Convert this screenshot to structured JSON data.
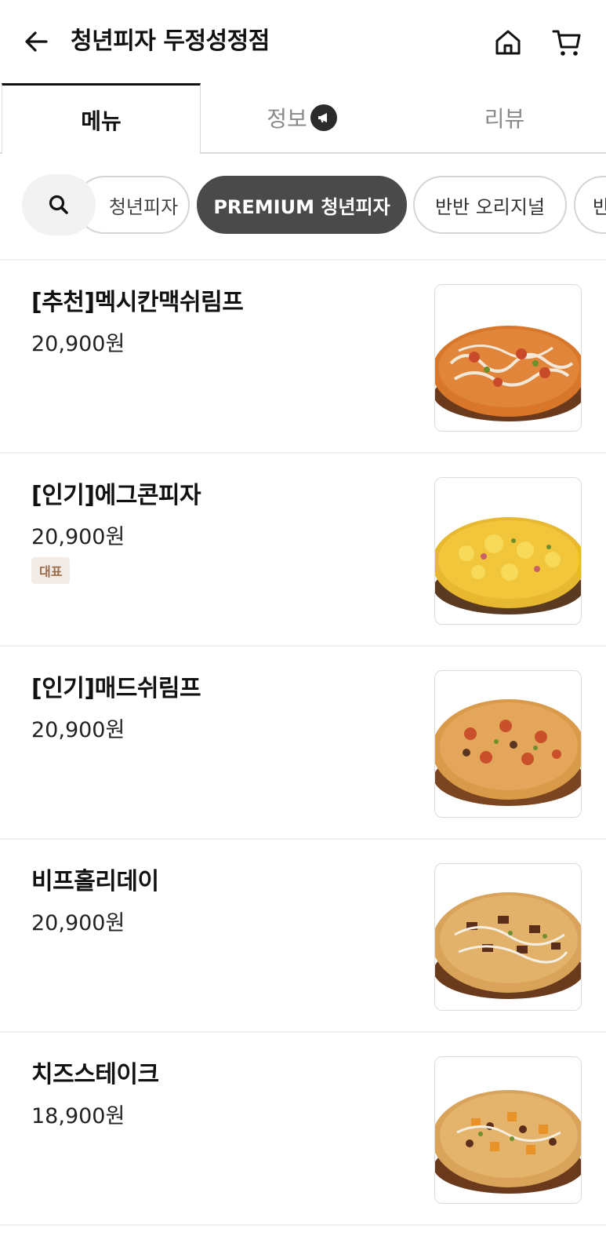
{
  "header": {
    "title": "청년피자 두정성정점",
    "back_icon": "arrow-left-icon",
    "home_icon": "home-icon",
    "cart_icon": "cart-icon"
  },
  "tabs": [
    {
      "label": "메뉴",
      "active": true
    },
    {
      "label": "정보",
      "active": false,
      "badge_icon": "megaphone-icon"
    },
    {
      "label": "리뷰",
      "active": false
    }
  ],
  "categories": {
    "search_icon": "search-icon",
    "chips": [
      {
        "label": "청년피자",
        "selected": false
      },
      {
        "label": "PREMIUM 청년피자",
        "selected": true
      },
      {
        "label": "반반 오리지널",
        "selected": false
      },
      {
        "label": "반",
        "selected": false
      }
    ]
  },
  "menu": [
    {
      "name": "[추천]멕시칸맥쉬림프",
      "price": "20,900원",
      "badge": ""
    },
    {
      "name": "[인기]에그콘피자",
      "price": "20,900원",
      "badge": "대표"
    },
    {
      "name": "[인기]매드쉬림프",
      "price": "20,900원",
      "badge": ""
    },
    {
      "name": "비프홀리데이",
      "price": "20,900원",
      "badge": ""
    },
    {
      "name": "치즈스테이크",
      "price": "18,900원",
      "badge": ""
    }
  ],
  "colors": {
    "active_chip_bg": "#4a4a4a",
    "badge_bg": "#f3ece6",
    "badge_text": "#9a6b4a"
  }
}
